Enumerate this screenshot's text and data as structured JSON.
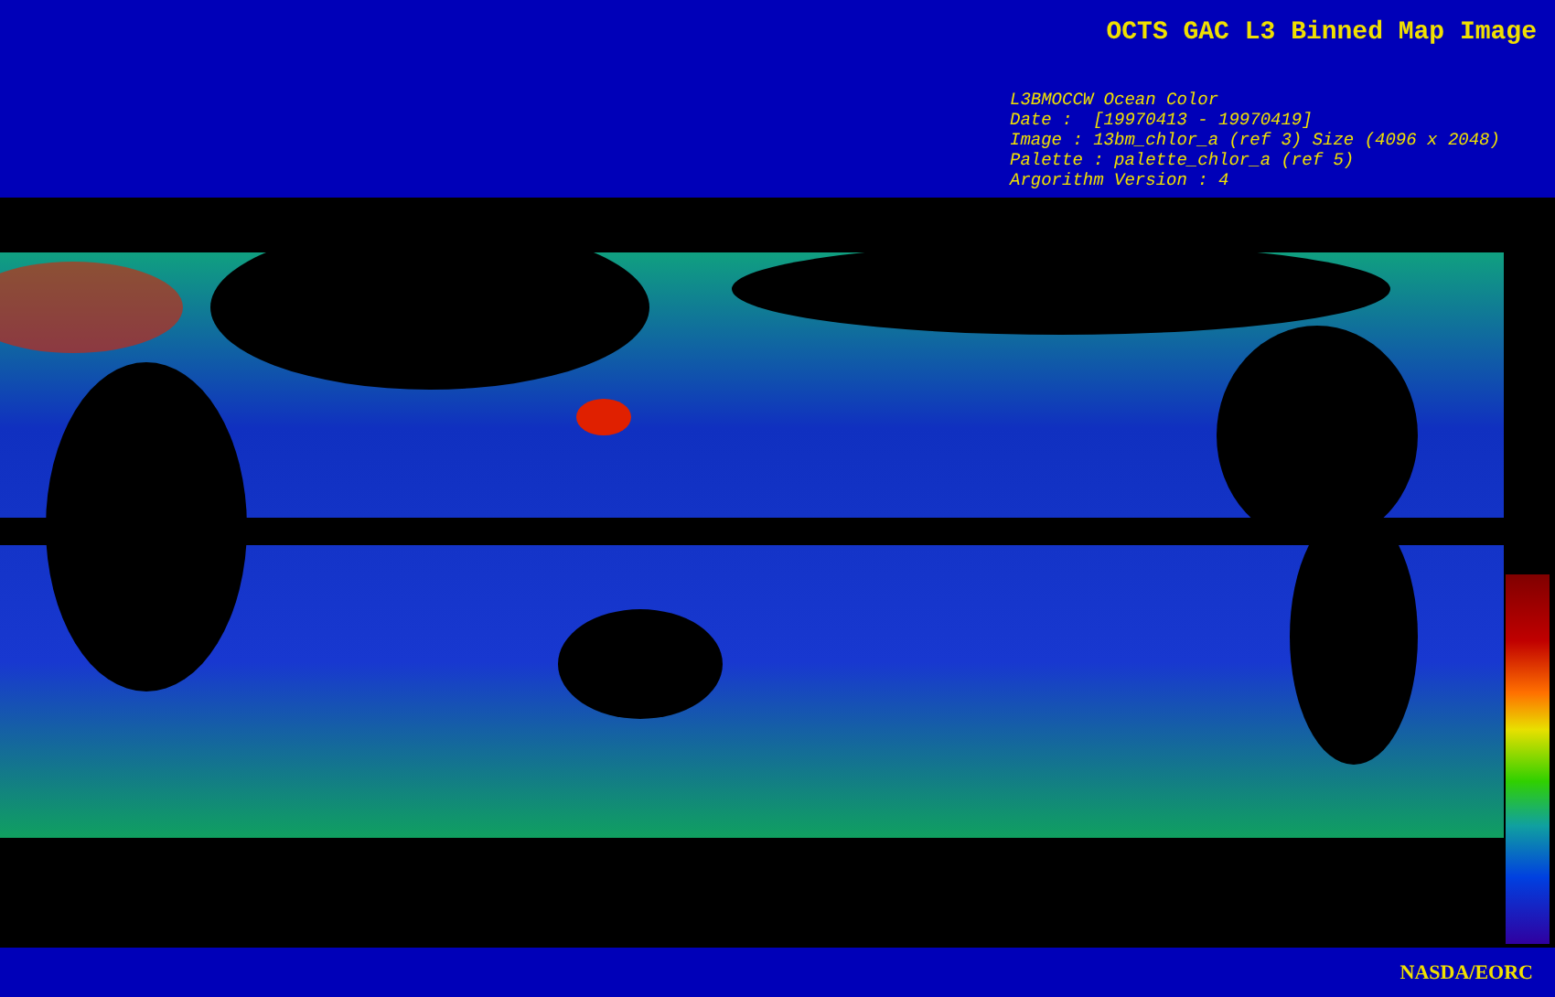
{
  "header": {
    "title": "OCTS GAC L3 Binned Map Image",
    "info_lines": [
      "L3BMOCCW Ocean Color",
      "Date :  [19970413 - 19970419]",
      "Image : 13bm_chlor_a (ref 3) Size (4096 x 2048)",
      "Palette : palette_chlor_a (ref 5)",
      "Argorithm Version : 4"
    ]
  },
  "footer": {
    "credit": "NASDA/EORC"
  }
}
